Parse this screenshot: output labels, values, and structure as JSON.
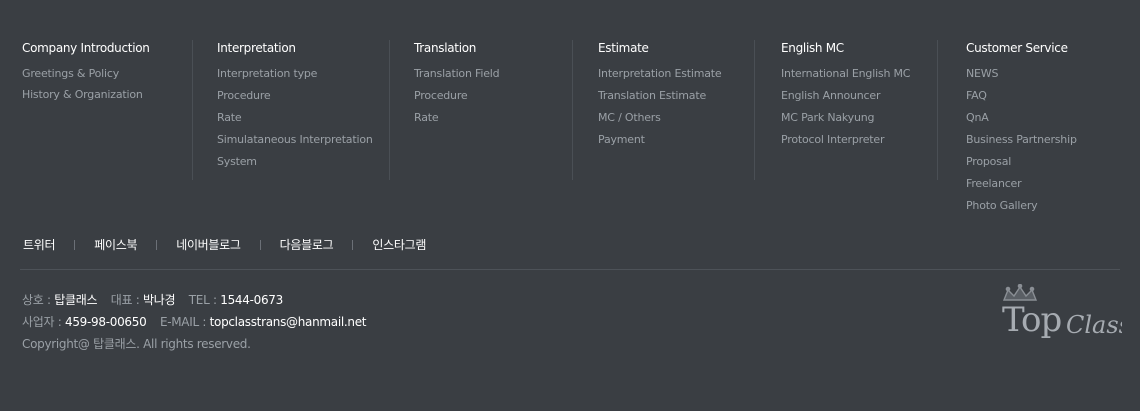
{
  "menu": {
    "col1": {
      "title": "Company Introduction",
      "items": [
        "Greetings & Policy",
        "History & Organization"
      ]
    },
    "col2": {
      "title": "Interpretation",
      "items": [
        "Interpretation type",
        "Procedure",
        "Rate",
        "Simulataneous Interpretation System"
      ]
    },
    "col3": {
      "title": "Translation",
      "items": [
        "Translation Field",
        "Procedure",
        "Rate"
      ]
    },
    "col4": {
      "title": "Estimate",
      "items": [
        "Interpretation Estimate",
        "Translation Estimate",
        "MC / Others",
        "Payment"
      ]
    },
    "col5": {
      "title": "English MC",
      "items": [
        "International English MC",
        "English Announcer",
        "MC Park Nakyung",
        "Protocol Interpreter"
      ]
    },
    "col6": {
      "title": "Customer Service",
      "items": [
        "NEWS",
        "FAQ",
        "QnA",
        "Business Partnership",
        "Proposal",
        "Freelancer",
        "Photo Gallery"
      ]
    }
  },
  "social": [
    "트위터",
    "페이스북",
    "네이버블로그",
    "다음블로그",
    "인스타그램"
  ],
  "info": {
    "company_label": "상호 :",
    "company": "탑클래스",
    "ceo_label": "대표 :",
    "ceo": "박나경",
    "tel_label": "TEL :",
    "tel": "1544-0673",
    "bizno_label": "사업자 :",
    "bizno": "459-98-00650",
    "email_label": "E-MAIL :",
    "email": "topclasstrans@hanmail.net",
    "copyright": "Copyright@ 탑클래스. All rights reserved."
  },
  "logo": {
    "main": "Top",
    "script": "Class"
  },
  "colors": {
    "background": "#3a3e43",
    "text_muted": "#9aa0a6",
    "text_strong": "#ffffff"
  }
}
